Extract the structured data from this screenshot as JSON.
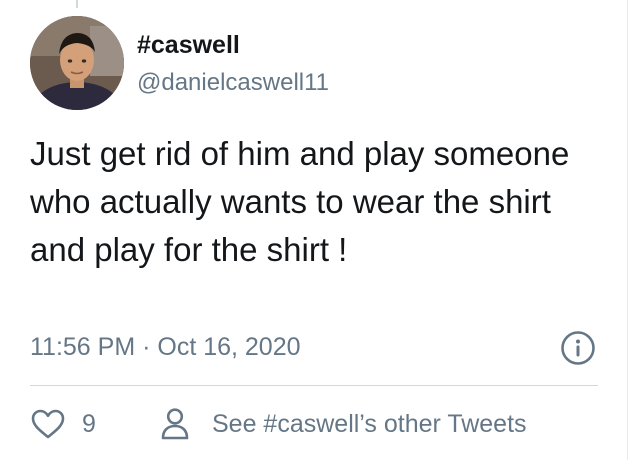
{
  "user": {
    "display_name": "#caswell",
    "handle": "@danielcaswell11",
    "avatar_icon": "user-photo"
  },
  "tweet": {
    "text": "Just get rid of him and play someone who actually wants to wear the shirt and play for the shirt !",
    "timestamp": "11:56 PM · Oct 16, 2020"
  },
  "actions": {
    "like_count": "9",
    "like_icon": "heart-icon",
    "other_tweets_label": "See #caswell’s other Tweets",
    "other_tweets_icon": "person-icon",
    "info_icon": "info-icon"
  },
  "colors": {
    "text_primary": "#14171a",
    "text_secondary": "#657786",
    "divider": "#cfd9de"
  }
}
